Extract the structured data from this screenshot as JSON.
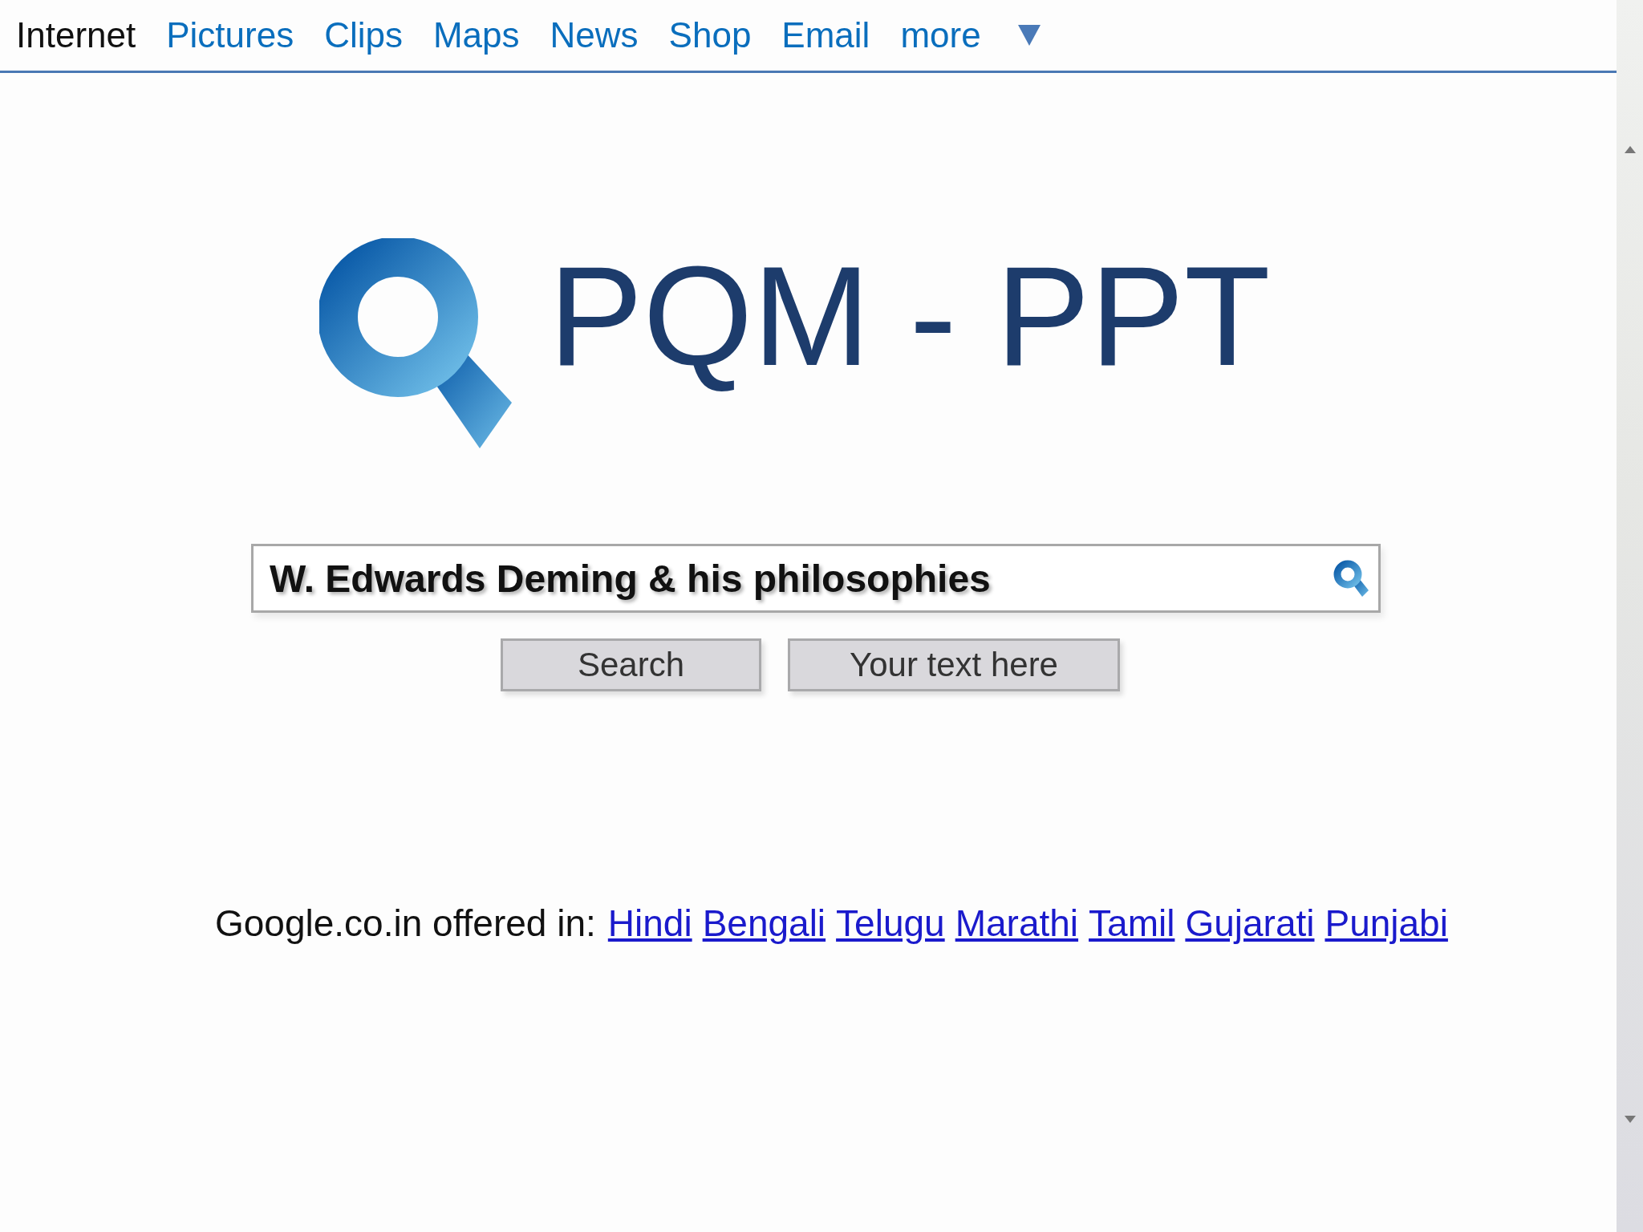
{
  "nav": {
    "tabs": [
      {
        "label": "Internet",
        "selected": true
      },
      {
        "label": "Pictures",
        "selected": false
      },
      {
        "label": "Clips",
        "selected": false
      },
      {
        "label": "Maps",
        "selected": false
      },
      {
        "label": "News",
        "selected": false
      },
      {
        "label": "Shop",
        "selected": false
      },
      {
        "label": "Email",
        "selected": false
      },
      {
        "label": "more",
        "selected": false
      }
    ]
  },
  "logo": {
    "title": "PQM - PPT"
  },
  "search": {
    "value": "W. Edwards Deming & his philosophies"
  },
  "buttons": [
    "Search",
    "Your text here"
  ],
  "footer": {
    "text": "Google.co.in offered in:",
    "links": [
      "Hindi",
      "Bengali",
      "Telugu",
      "Marathi",
      "Tamil",
      "Gujarati",
      "Punjabi"
    ]
  }
}
